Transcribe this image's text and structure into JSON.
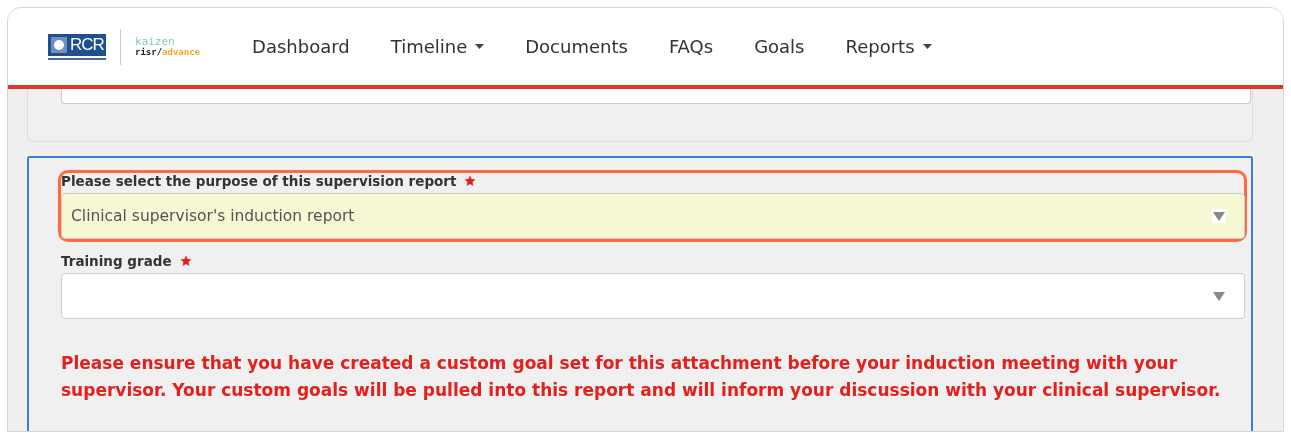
{
  "nav": {
    "logo": {
      "mark": "RCR",
      "product": "kaizen",
      "brand": "risr/",
      "brand_accent": "advance"
    },
    "items": [
      {
        "label": "Dashboard",
        "dropdown": false
      },
      {
        "label": "Timeline",
        "dropdown": true
      },
      {
        "label": "Documents",
        "dropdown": false
      },
      {
        "label": "FAQs",
        "dropdown": false
      },
      {
        "label": "Goals",
        "dropdown": false
      },
      {
        "label": "Reports",
        "dropdown": true
      }
    ]
  },
  "form": {
    "fields": [
      {
        "label": "Please select the purpose of this supervision report",
        "required": true,
        "value": "Clinical supervisor's induction report",
        "highlighted": true
      },
      {
        "label": "Training grade",
        "required": true,
        "highlighted": false
      }
    ],
    "notice": "Please ensure that you have created a custom goal set for this attachment before your induction meeting with your supervisor. Your custom goals will be pulled into this report and will inform your discussion with your clinical supervisor."
  }
}
